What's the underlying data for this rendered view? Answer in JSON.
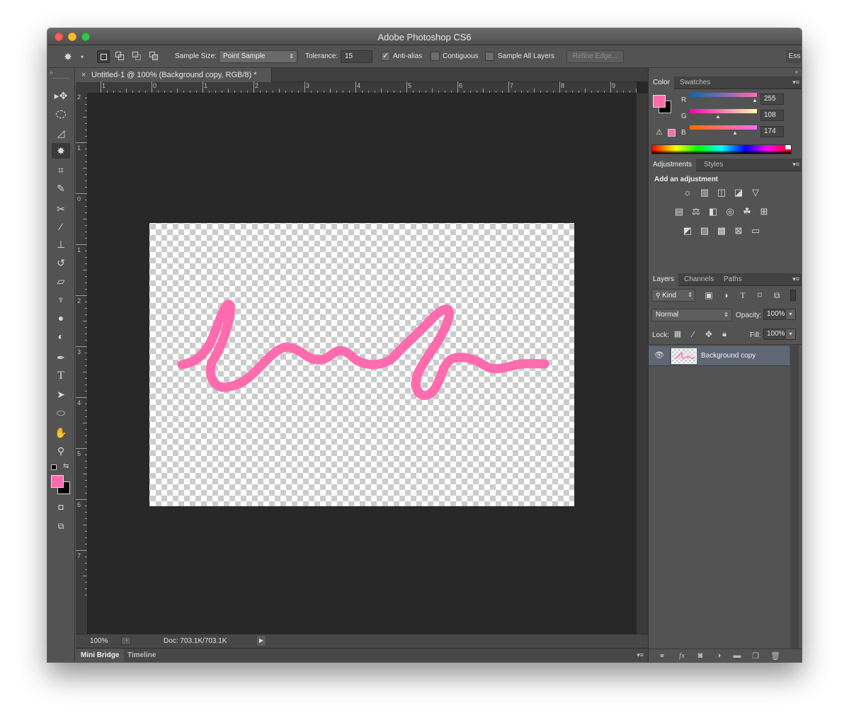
{
  "window": {
    "title": "Adobe Photoshop CS6"
  },
  "options_bar": {
    "sample_size_label": "Sample Size:",
    "sample_size_value": "Point Sample",
    "tolerance_label": "Tolerance:",
    "tolerance_value": "15",
    "anti_alias_label": "Anti-alias",
    "anti_alias_checked": true,
    "contiguous_label": "Contiguous",
    "contiguous_checked": false,
    "sample_all_layers_label": "Sample All Layers",
    "sample_all_layers_checked": false,
    "refine_edge_label": "Refine Edge...",
    "workspace_label": "Ess"
  },
  "document": {
    "tab_title": "Untitled-1 @ 100% (Background copy, RGB/8) *",
    "tab_close": "×",
    "zoom": "100%",
    "doc_info": "Doc: 703.1K/703.1K",
    "stroke_color": "#ff6cae"
  },
  "rulers": {
    "horizontal": [
      "1",
      "0",
      "1",
      "2",
      "3",
      "4",
      "5",
      "6",
      "7",
      "8",
      "9"
    ],
    "vertical": [
      "2",
      "1",
      "0",
      "1",
      "2",
      "3",
      "4",
      "5",
      "6",
      "7"
    ]
  },
  "bottom_tabs": [
    "Mini Bridge",
    "Timeline"
  ],
  "color_panel": {
    "tabs": [
      "Color",
      "Swatches"
    ],
    "r_label": "R",
    "r_value": "255",
    "g_label": "G",
    "g_value": "108",
    "b_label": "B",
    "b_value": "174",
    "foreground": "#ff6cae",
    "background": "#000000"
  },
  "adjustments_panel": {
    "tabs": [
      "Adjustments",
      "Styles"
    ],
    "heading": "Add an adjustment"
  },
  "layers_panel": {
    "tabs": [
      "Layers",
      "Channels",
      "Paths"
    ],
    "filter_kind": "Kind",
    "blend_mode": "Normal",
    "opacity_label": "Opacity:",
    "opacity_value": "100%",
    "lock_label": "Lock:",
    "fill_label": "Fill:",
    "fill_value": "100%",
    "layers": [
      {
        "name": "Background copy",
        "visible": true
      }
    ]
  }
}
